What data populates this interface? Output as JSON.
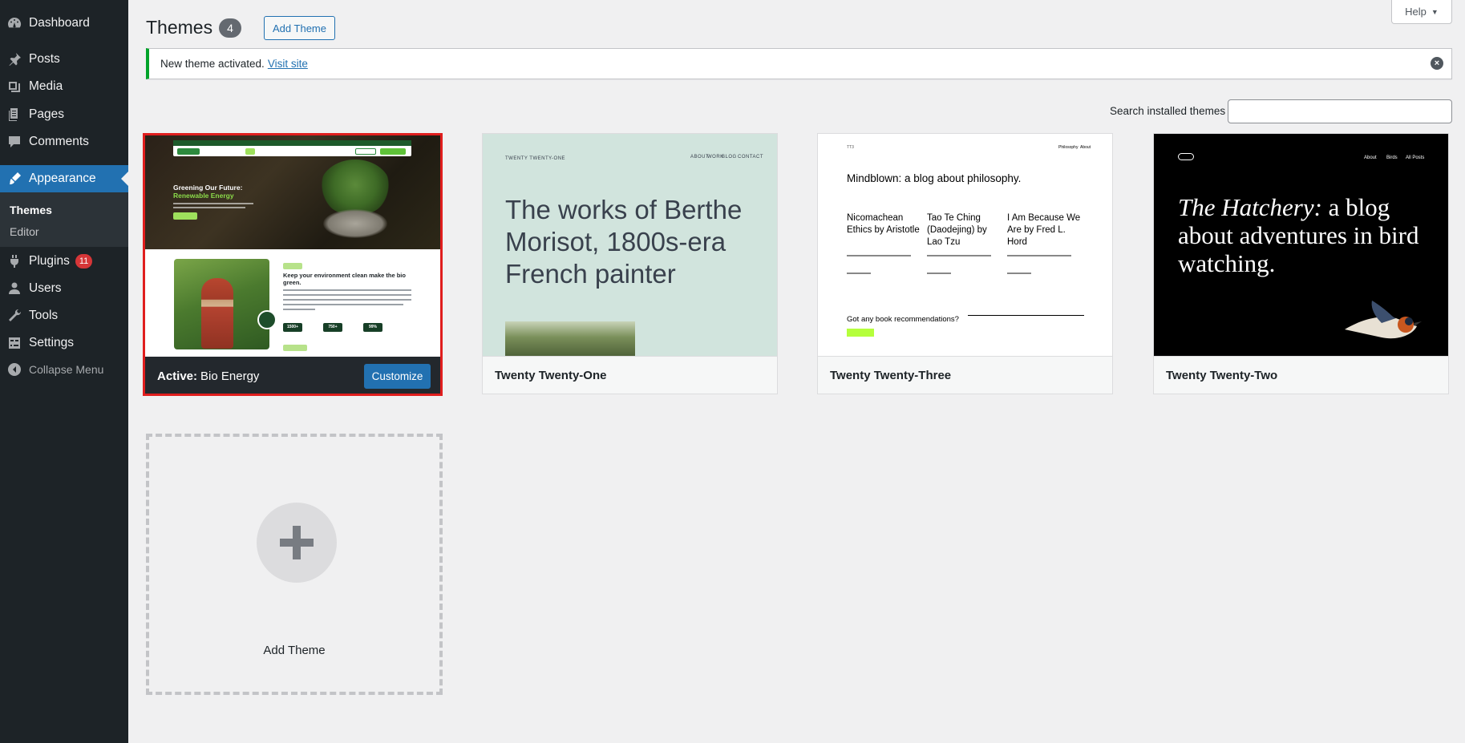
{
  "sidebar": {
    "items": [
      {
        "label": "Dashboard",
        "icon": "dashboard-icon"
      },
      {
        "label": "Posts",
        "icon": "pin-icon"
      },
      {
        "label": "Media",
        "icon": "media-icon"
      },
      {
        "label": "Pages",
        "icon": "pages-icon"
      },
      {
        "label": "Comments",
        "icon": "comment-icon"
      },
      {
        "label": "Appearance",
        "icon": "brush-icon"
      },
      {
        "label": "Plugins",
        "icon": "plug-icon",
        "badge": "11"
      },
      {
        "label": "Users",
        "icon": "users-icon"
      },
      {
        "label": "Tools",
        "icon": "wrench-icon"
      },
      {
        "label": "Settings",
        "icon": "settings-icon"
      }
    ],
    "submenu": [
      {
        "label": "Themes"
      },
      {
        "label": "Editor"
      }
    ],
    "collapse_label": "Collapse Menu"
  },
  "header": {
    "title": "Themes",
    "count": "4",
    "add_theme_label": "Add Theme",
    "help_label": "Help"
  },
  "notice": {
    "text": "New theme activated.",
    "link_label": "Visit site"
  },
  "search": {
    "label": "Search installed themes",
    "value": ""
  },
  "themes": [
    {
      "active_prefix": "Active:",
      "name": "Bio Energy",
      "customize_label": "Customize",
      "preview": {
        "title_line1": "Greening Our Future:",
        "title_line2": "Renewable Energy",
        "heading": "Keep your environment clean make the bio green.",
        "stats": [
          "1500+",
          "750+",
          "99%"
        ]
      }
    },
    {
      "name": "Twenty Twenty-One",
      "preview": {
        "site": "TWENTY TWENTY-ONE",
        "nav": [
          "ABOUT",
          "WORK",
          "BLOG",
          "CONTACT"
        ],
        "headline": "The works of Berthe Morisot, 1800s-era French painter"
      }
    },
    {
      "name": "Twenty Twenty-Three",
      "preview": {
        "site": "TT3",
        "nav": [
          "Philosophy",
          "About"
        ],
        "headline": "Mindblown: a blog about philosophy.",
        "posts": [
          "Nicomachean Ethics by Aristotle",
          "Tao Te Ching (Daodejing) by Lao Tzu",
          "I Am Because We Are by Fred L. Hord"
        ],
        "question": "Got any book recommendations?"
      }
    },
    {
      "name": "Twenty Twenty-Two",
      "preview": {
        "headline_italic": "The Hatchery:",
        "headline_rest": " a blog about adventures in bird watching.",
        "nav": [
          "About",
          "Birds",
          "All Posts"
        ]
      }
    }
  ],
  "add_card": {
    "label": "Add Theme"
  },
  "colors": {
    "accent": "#2271b1",
    "sidebar": "#1d2327",
    "notice_success": "#00a32a",
    "badge": "#d63638",
    "highlight_border": "#e01e1e"
  }
}
